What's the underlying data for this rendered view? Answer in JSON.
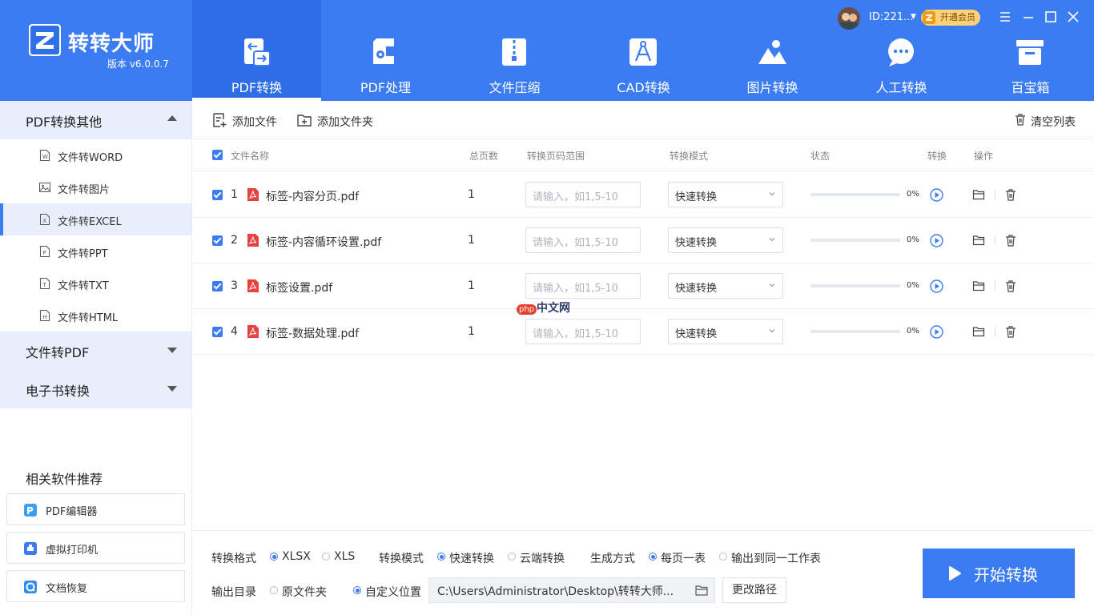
{
  "app": {
    "name": "转转大师",
    "version": "版本 v6.0.0.7"
  },
  "user": {
    "id": "ID:221...",
    "vip_label": "开通会员"
  },
  "nav": {
    "tabs": [
      {
        "label": "PDF转换",
        "icon": "pdf-convert-icon",
        "active": true
      },
      {
        "label": "PDF处理",
        "icon": "pdf-process-icon",
        "active": false
      },
      {
        "label": "文件压缩",
        "icon": "file-compress-icon",
        "active": false
      },
      {
        "label": "CAD转换",
        "icon": "cad-convert-icon",
        "active": false
      },
      {
        "label": "图片转换",
        "icon": "image-convert-icon",
        "active": false
      },
      {
        "label": "人工转换",
        "icon": "manual-convert-icon",
        "active": false
      },
      {
        "label": "百宝箱",
        "icon": "toolbox-icon",
        "active": false
      }
    ]
  },
  "sidebar": {
    "categories": [
      {
        "label": "PDF转换其他",
        "expanded": true
      },
      {
        "label": "文件转PDF",
        "expanded": false
      },
      {
        "label": "电子书转换",
        "expanded": false
      }
    ],
    "items": [
      {
        "label": "文件转WORD",
        "icon": "word-file-icon",
        "glyph": "W"
      },
      {
        "label": "文件转图片",
        "icon": "image-file-icon",
        "glyph": ""
      },
      {
        "label": "文件转EXCEL",
        "icon": "excel-file-icon",
        "glyph": "X",
        "active": true
      },
      {
        "label": "文件转PPT",
        "icon": "ppt-file-icon",
        "glyph": "P"
      },
      {
        "label": "文件转TXT",
        "icon": "txt-file-icon",
        "glyph": "T"
      },
      {
        "label": "文件转HTML",
        "icon": "html-file-icon",
        "glyph": "H"
      }
    ],
    "recommend_title": "相关软件推荐",
    "recommend": [
      {
        "label": "PDF编辑器",
        "icon": "pdf-editor-icon"
      },
      {
        "label": "虚拟打印机",
        "icon": "virtual-printer-icon"
      },
      {
        "label": "文档恢复",
        "icon": "doc-recovery-icon"
      }
    ]
  },
  "toolbar": {
    "add_file": "添加文件",
    "add_folder": "添加文件夹",
    "clear_list": "清空列表"
  },
  "table": {
    "headers": {
      "name": "文件名称",
      "pages": "总页数",
      "range": "转换页码范围",
      "mode": "转换模式",
      "status": "状态",
      "convert": "转换",
      "action": "操作"
    },
    "range_placeholder": "请输入，如1,5-10",
    "rows": [
      {
        "index": "1",
        "name": "标签-内容分页.pdf",
        "pages": "1",
        "mode": "快速转换",
        "progress": 0,
        "percent": "0%"
      },
      {
        "index": "2",
        "name": "标签-内容循环设置.pdf",
        "pages": "1",
        "mode": "快速转换",
        "progress": 0,
        "percent": "0%"
      },
      {
        "index": "3",
        "name": "标签设置.pdf",
        "pages": "1",
        "mode": "快速转换",
        "progress": 0,
        "percent": "0%"
      },
      {
        "index": "4",
        "name": "标签-数据处理.pdf",
        "pages": "1",
        "mode": "快速转换",
        "progress": 0,
        "percent": "0%"
      }
    ]
  },
  "watermark": {
    "badge": "php",
    "text": "中文网"
  },
  "bottom": {
    "format_label": "转换格式",
    "format_options": [
      "XLSX",
      "XLS"
    ],
    "format_selected": "XLSX",
    "mode_label": "转换模式",
    "mode_options": [
      "快速转换",
      "云端转换"
    ],
    "mode_selected": "快速转换",
    "gen_label": "生成方式",
    "gen_options": [
      "每页一表",
      "输出到同一工作表"
    ],
    "gen_selected": "每页一表",
    "output_label": "输出目录",
    "output_options": [
      "原文件夹",
      "自定义位置"
    ],
    "output_selected": "自定义位置",
    "output_path": "C:\\Users\\Administrator\\Desktop\\转转大师...",
    "change_path": "更改路径",
    "start": "开始转换"
  },
  "colors": {
    "brand": "#3c7cf2",
    "header_active": "#2e6de6",
    "pdf_red": "#e8423f",
    "vip_gold": "#ffd27a"
  }
}
